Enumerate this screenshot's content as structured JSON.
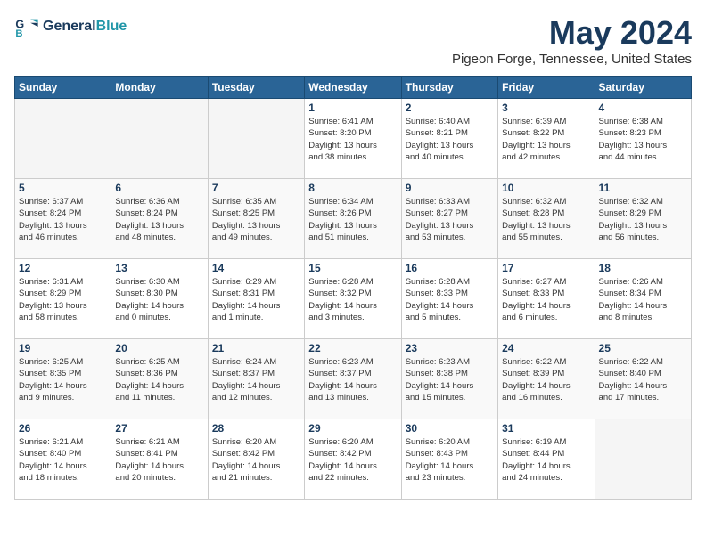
{
  "logo": {
    "line1": "General",
    "line2": "Blue"
  },
  "title": "May 2024",
  "location": "Pigeon Forge, Tennessee, United States",
  "weekdays": [
    "Sunday",
    "Monday",
    "Tuesday",
    "Wednesday",
    "Thursday",
    "Friday",
    "Saturday"
  ],
  "weeks": [
    [
      {
        "day": "",
        "info": ""
      },
      {
        "day": "",
        "info": ""
      },
      {
        "day": "",
        "info": ""
      },
      {
        "day": "1",
        "info": "Sunrise: 6:41 AM\nSunset: 8:20 PM\nDaylight: 13 hours\nand 38 minutes."
      },
      {
        "day": "2",
        "info": "Sunrise: 6:40 AM\nSunset: 8:21 PM\nDaylight: 13 hours\nand 40 minutes."
      },
      {
        "day": "3",
        "info": "Sunrise: 6:39 AM\nSunset: 8:22 PM\nDaylight: 13 hours\nand 42 minutes."
      },
      {
        "day": "4",
        "info": "Sunrise: 6:38 AM\nSunset: 8:23 PM\nDaylight: 13 hours\nand 44 minutes."
      }
    ],
    [
      {
        "day": "5",
        "info": "Sunrise: 6:37 AM\nSunset: 8:24 PM\nDaylight: 13 hours\nand 46 minutes."
      },
      {
        "day": "6",
        "info": "Sunrise: 6:36 AM\nSunset: 8:24 PM\nDaylight: 13 hours\nand 48 minutes."
      },
      {
        "day": "7",
        "info": "Sunrise: 6:35 AM\nSunset: 8:25 PM\nDaylight: 13 hours\nand 49 minutes."
      },
      {
        "day": "8",
        "info": "Sunrise: 6:34 AM\nSunset: 8:26 PM\nDaylight: 13 hours\nand 51 minutes."
      },
      {
        "day": "9",
        "info": "Sunrise: 6:33 AM\nSunset: 8:27 PM\nDaylight: 13 hours\nand 53 minutes."
      },
      {
        "day": "10",
        "info": "Sunrise: 6:32 AM\nSunset: 8:28 PM\nDaylight: 13 hours\nand 55 minutes."
      },
      {
        "day": "11",
        "info": "Sunrise: 6:32 AM\nSunset: 8:29 PM\nDaylight: 13 hours\nand 56 minutes."
      }
    ],
    [
      {
        "day": "12",
        "info": "Sunrise: 6:31 AM\nSunset: 8:29 PM\nDaylight: 13 hours\nand 58 minutes."
      },
      {
        "day": "13",
        "info": "Sunrise: 6:30 AM\nSunset: 8:30 PM\nDaylight: 14 hours\nand 0 minutes."
      },
      {
        "day": "14",
        "info": "Sunrise: 6:29 AM\nSunset: 8:31 PM\nDaylight: 14 hours\nand 1 minute."
      },
      {
        "day": "15",
        "info": "Sunrise: 6:28 AM\nSunset: 8:32 PM\nDaylight: 14 hours\nand 3 minutes."
      },
      {
        "day": "16",
        "info": "Sunrise: 6:28 AM\nSunset: 8:33 PM\nDaylight: 14 hours\nand 5 minutes."
      },
      {
        "day": "17",
        "info": "Sunrise: 6:27 AM\nSunset: 8:33 PM\nDaylight: 14 hours\nand 6 minutes."
      },
      {
        "day": "18",
        "info": "Sunrise: 6:26 AM\nSunset: 8:34 PM\nDaylight: 14 hours\nand 8 minutes."
      }
    ],
    [
      {
        "day": "19",
        "info": "Sunrise: 6:25 AM\nSunset: 8:35 PM\nDaylight: 14 hours\nand 9 minutes."
      },
      {
        "day": "20",
        "info": "Sunrise: 6:25 AM\nSunset: 8:36 PM\nDaylight: 14 hours\nand 11 minutes."
      },
      {
        "day": "21",
        "info": "Sunrise: 6:24 AM\nSunset: 8:37 PM\nDaylight: 14 hours\nand 12 minutes."
      },
      {
        "day": "22",
        "info": "Sunrise: 6:23 AM\nSunset: 8:37 PM\nDaylight: 14 hours\nand 13 minutes."
      },
      {
        "day": "23",
        "info": "Sunrise: 6:23 AM\nSunset: 8:38 PM\nDaylight: 14 hours\nand 15 minutes."
      },
      {
        "day": "24",
        "info": "Sunrise: 6:22 AM\nSunset: 8:39 PM\nDaylight: 14 hours\nand 16 minutes."
      },
      {
        "day": "25",
        "info": "Sunrise: 6:22 AM\nSunset: 8:40 PM\nDaylight: 14 hours\nand 17 minutes."
      }
    ],
    [
      {
        "day": "26",
        "info": "Sunrise: 6:21 AM\nSunset: 8:40 PM\nDaylight: 14 hours\nand 18 minutes."
      },
      {
        "day": "27",
        "info": "Sunrise: 6:21 AM\nSunset: 8:41 PM\nDaylight: 14 hours\nand 20 minutes."
      },
      {
        "day": "28",
        "info": "Sunrise: 6:20 AM\nSunset: 8:42 PM\nDaylight: 14 hours\nand 21 minutes."
      },
      {
        "day": "29",
        "info": "Sunrise: 6:20 AM\nSunset: 8:42 PM\nDaylight: 14 hours\nand 22 minutes."
      },
      {
        "day": "30",
        "info": "Sunrise: 6:20 AM\nSunset: 8:43 PM\nDaylight: 14 hours\nand 23 minutes."
      },
      {
        "day": "31",
        "info": "Sunrise: 6:19 AM\nSunset: 8:44 PM\nDaylight: 14 hours\nand 24 minutes."
      },
      {
        "day": "",
        "info": ""
      }
    ]
  ]
}
